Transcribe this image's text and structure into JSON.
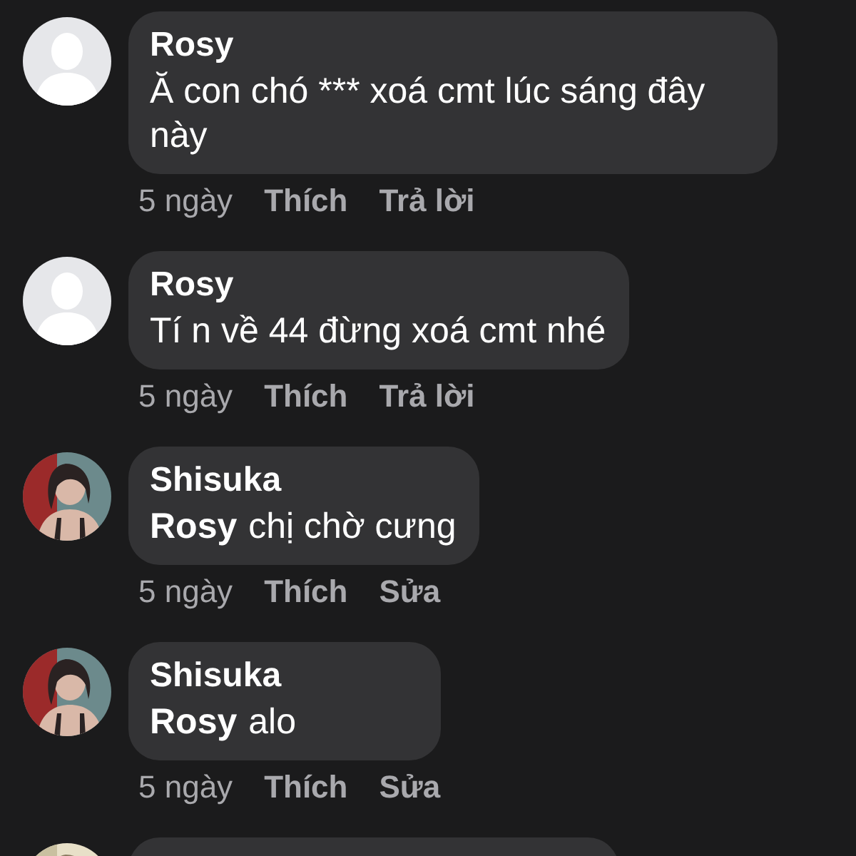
{
  "comments": [
    {
      "avatar": {
        "kind": "default"
      },
      "name": "Rosy",
      "text": "Ă con chó *** xoá cmt lúc sáng đây này",
      "actions": {
        "time": "5 ngày",
        "like": "Thích",
        "reply": "Trả lời"
      }
    },
    {
      "avatar": {
        "kind": "default"
      },
      "name": "Rosy",
      "text": "Tí n về 44 đừng xoá cmt nhé",
      "actions": {
        "time": "5 ngày",
        "like": "Thích",
        "reply": "Trả lời"
      }
    },
    {
      "name": "Shisuka",
      "mention": "Rosy",
      "text": "chị chờ cưng",
      "actions": {
        "time": "5 ngày",
        "like": "Thích",
        "reply": "Sửa"
      }
    },
    {
      "name": "Shisuka",
      "mention": "Rosy",
      "text": "alo",
      "actions": {
        "time": "5 ngày",
        "like": "Thích",
        "reply": "Sửa"
      }
    }
  ],
  "partial_comment": {
    "avatar": {
      "kind": "photo-light"
    }
  }
}
